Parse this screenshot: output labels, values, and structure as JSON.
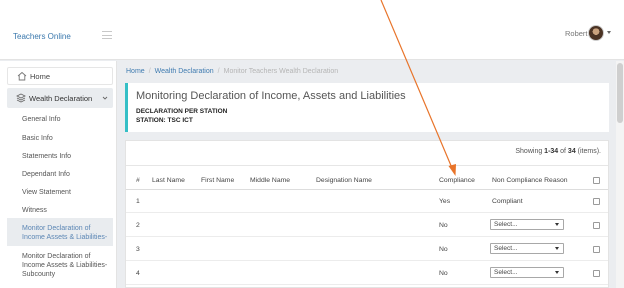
{
  "header": {
    "brand": "Teachers Online",
    "user_name": "Robert",
    "icons": [
      "menu-icon",
      "avatar",
      "caret-down-icon"
    ]
  },
  "sidebar": {
    "home_label": "Home",
    "wealth_label": "Wealth Declaration",
    "items": [
      {
        "label": "General Info"
      },
      {
        "label": "Basic Info"
      },
      {
        "label": "Statements Info"
      },
      {
        "label": "Dependant Info"
      },
      {
        "label": "View Statement"
      },
      {
        "label": "Witness"
      },
      {
        "label": "Monitor Declaration of Income Assets & Liabilities-"
      },
      {
        "label": "Monitor Declaration of Income Assets & Liabilities-Subcounty"
      }
    ],
    "icons": [
      "home-icon",
      "wealth-icon",
      "chevron-down-icon"
    ]
  },
  "breadcrumb": {
    "home": "Home",
    "parent": "Wealth Declaration",
    "current": "Monitor Teachers Wealth Declaration"
  },
  "panel": {
    "title": "Monitoring Declaration of Income, Assets and Liabilities",
    "subtitle1": "DECLARATION PER STATION",
    "subtitle2": "STATION: TSC ICT"
  },
  "table": {
    "summary_prefix": "Showing ",
    "summary_range": "1-34",
    "summary_of": " of ",
    "summary_total": "34",
    "summary_suffix": " (items).",
    "columns": {
      "num": "#",
      "last_name": "Last Name",
      "first_name": "First Name",
      "middle_name": "Middle Name",
      "designation": "Designation Name",
      "compliance": "Compliance",
      "reason": "Non Compliance Reason"
    },
    "rows": [
      {
        "num": "1",
        "compliance": "Yes",
        "reason": "Compliant"
      },
      {
        "num": "2",
        "compliance": "No",
        "reason": "Select..."
      },
      {
        "num": "3",
        "compliance": "No",
        "reason": "Select..."
      },
      {
        "num": "4",
        "compliance": "No",
        "reason": "Select..."
      }
    ]
  },
  "colors": {
    "accent": "#35bfc6",
    "link": "#3f7bb0",
    "annotation_arrow": "#e8742a"
  }
}
